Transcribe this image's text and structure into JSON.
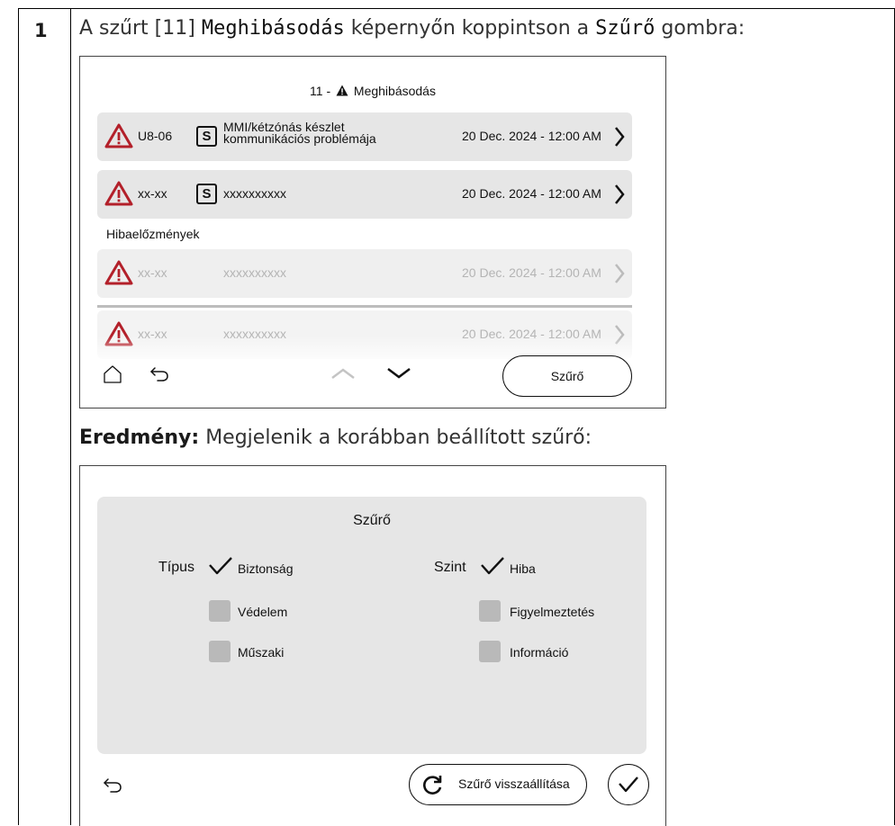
{
  "step": {
    "number": "1",
    "text_before": "A szűrt [11] ",
    "screen_name": "Meghibásodás",
    "text_middle": " képernyőn koppintson a ",
    "button_name": "Szűrő",
    "text_after": " gombra:"
  },
  "fault_screen": {
    "title_prefix": "11 -",
    "title": "Meghibásodás",
    "active_faults": [
      {
        "code": "U8-06",
        "badge": "S",
        "description_line1": "MMI/kétzónás készlet",
        "description_line2": "kommunikációs problémája",
        "date": "20 Dec. 2024 - 12:00 AM"
      },
      {
        "code": "xx-xx",
        "badge": "S",
        "description": "xxxxxxxxxx",
        "date": "20 Dec. 2024 - 12:00 AM"
      }
    ],
    "history_label": "Hibaelőzmények",
    "history_faults": [
      {
        "code": "xx-xx",
        "description": "xxxxxxxxxx",
        "date": "20 Dec. 2024 - 12:00 AM"
      },
      {
        "code": "xx-xx",
        "description": "xxxxxxxxxx",
        "date": "20 Dec. 2024 - 12:00 AM"
      }
    ],
    "filter_button": "Szűrő"
  },
  "result": {
    "label": "Eredmény:",
    "text": "Megjelenik a korábban beállított szűrő:"
  },
  "filter_screen": {
    "title": "Szűrő",
    "type_label": "Típus",
    "level_label": "Szint",
    "type_options": [
      {
        "label": "Biztonság",
        "checked": true
      },
      {
        "label": "Védelem",
        "checked": false
      },
      {
        "label": "Műszaki",
        "checked": false
      }
    ],
    "level_options": [
      {
        "label": "Hiba",
        "checked": true
      },
      {
        "label": "Figyelmeztetés",
        "checked": false
      },
      {
        "label": "Információ",
        "checked": false
      }
    ],
    "reset_button": "Szűrő visszaállítása"
  },
  "colors": {
    "warning_red": "#b3202a",
    "row_gray": "#e6e6e6",
    "checkbox_gray": "#b9b9b9",
    "muted_text": "#b4b4b4"
  }
}
